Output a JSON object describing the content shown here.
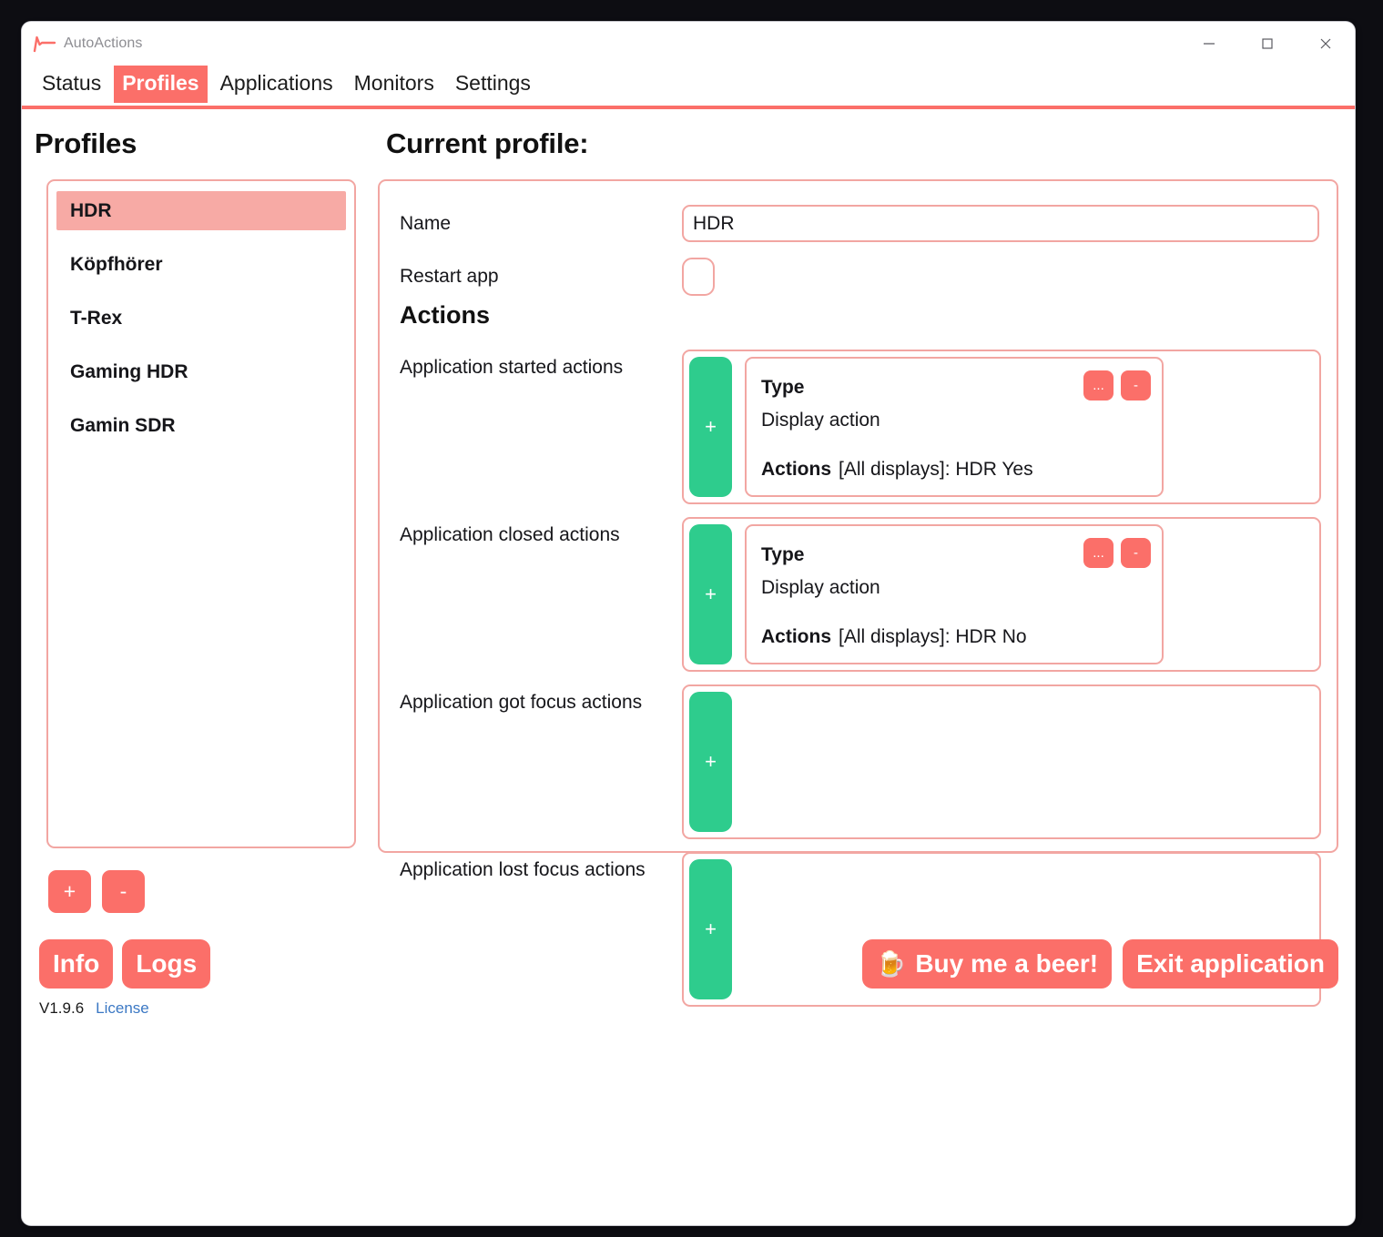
{
  "window": {
    "title": "AutoActions",
    "logo_icon": "pulse-logo-icon",
    "controls": [
      {
        "name": "minimize",
        "icon": "minimize-icon"
      },
      {
        "name": "maximize",
        "icon": "maximize-icon"
      },
      {
        "name": "close",
        "icon": "close-icon"
      }
    ]
  },
  "colors": {
    "accent": "#fb6f69",
    "accent_soft": "#f2a6a2",
    "selection": "#f7aaa5",
    "green": "#2ecc8d",
    "link": "#3b78c4",
    "desktop": "#0d0d12"
  },
  "tabs": [
    {
      "label": "Status",
      "active": false
    },
    {
      "label": "Profiles",
      "active": true
    },
    {
      "label": "Applications",
      "active": false
    },
    {
      "label": "Monitors",
      "active": false
    },
    {
      "label": "Settings",
      "active": false
    }
  ],
  "profiles": {
    "heading": "Profiles",
    "items": [
      {
        "label": "HDR",
        "selected": true
      },
      {
        "label": "Köpfhörer",
        "selected": false
      },
      {
        "label": "T-Rex",
        "selected": false
      },
      {
        "label": "Gaming HDR",
        "selected": false
      },
      {
        "label": "Gamin SDR",
        "selected": false
      }
    ],
    "add_label": "+",
    "remove_label": "-"
  },
  "current_profile": {
    "heading": "Current profile:",
    "name_label": "Name",
    "name_value": "HDR",
    "name_placeholder": "",
    "restart_label": "Restart app",
    "restart_checked": false,
    "actions_heading": "Actions",
    "action_groups": [
      {
        "label": "Application started actions",
        "add_label": "+",
        "cards": [
          {
            "type_label": "Type",
            "type_value": "Display action",
            "actions_label": "Actions",
            "actions_value": "[All displays]: HDR Yes",
            "edit_label": "...",
            "remove_label": "-"
          }
        ]
      },
      {
        "label": "Application closed actions",
        "add_label": "+",
        "cards": [
          {
            "type_label": "Type",
            "type_value": "Display action",
            "actions_label": "Actions",
            "actions_value": "[All displays]: HDR No",
            "edit_label": "...",
            "remove_label": "-"
          }
        ]
      },
      {
        "label": "Application got focus actions",
        "add_label": "+",
        "cards": []
      },
      {
        "label": "Application lost focus actions",
        "add_label": "+",
        "cards": []
      }
    ]
  },
  "footer": {
    "info_label": "Info",
    "logs_label": "Logs",
    "version": "V1.9.6",
    "license_label": "License",
    "beer_icon": "🍺",
    "beer_label": "Buy me a beer!",
    "exit_label": "Exit application"
  }
}
